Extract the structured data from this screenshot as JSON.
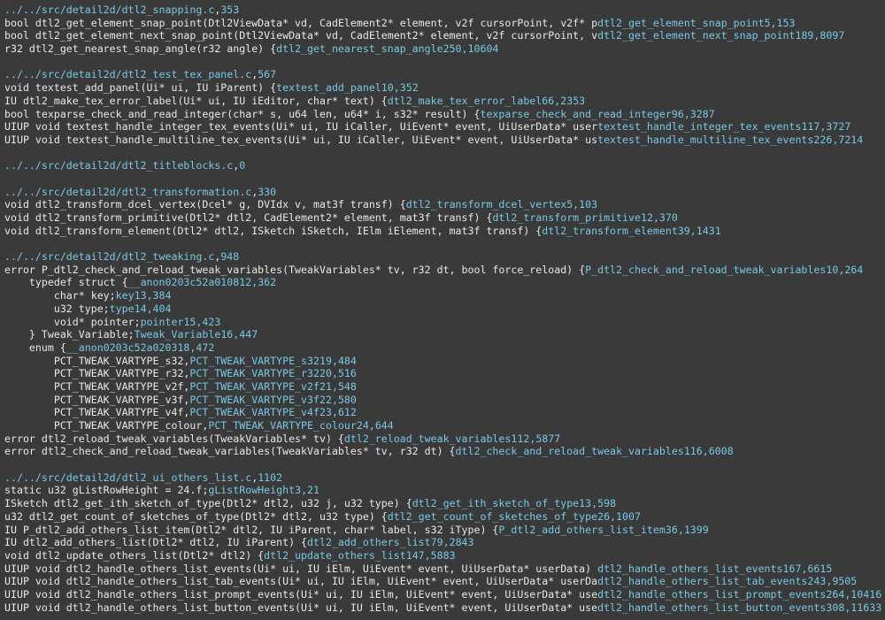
{
  "colors": {
    "background": "#3a3a3a",
    "code_text": "#e8e8e8",
    "tag_text": "#78c8e6"
  },
  "lines": [
    {
      "type": "file",
      "path": "../../src/detail2d/dtl2_snapping.c",
      "size": "353"
    },
    {
      "type": "code",
      "text": "bool dtl2_get_element_snap_point(Dtl2ViewData* vd, CadElement2* element, v2f cursorPoint, v2f* p",
      "tag": "dtl2_get_element_snap_point",
      "a": "5",
      "b": "153"
    },
    {
      "type": "code",
      "text": "bool dtl2_get_element_next_snap_point(Dtl2ViewData* vd, CadElement2* element, v2f cursorPoint, v",
      "tag": "dtl2_get_element_next_snap_point",
      "a": "189",
      "b": "8097"
    },
    {
      "type": "code",
      "text": "r32 dtl2_get_nearest_snap_angle(r32 angle) {",
      "tag": "dtl2_get_nearest_snap_angle",
      "a": "250",
      "b": "10604"
    },
    {
      "type": "blank"
    },
    {
      "type": "file",
      "path": "../../src/detail2d/dtl2_test_tex_panel.c",
      "size": "567"
    },
    {
      "type": "code",
      "text": "void textest_add_panel(Ui* ui, IU iParent) {",
      "tag": "textest_add_panel",
      "a": "10",
      "b": "352"
    },
    {
      "type": "code",
      "text": "IU dtl2_make_tex_error_label(Ui* ui, IU iEditor, char* text) {",
      "tag": "dtl2_make_tex_error_label",
      "a": "66",
      "b": "2353"
    },
    {
      "type": "code",
      "text": "bool texparse_check_and_read_integer(char* s, u64 len, u64* i, s32* result) {",
      "tag": "texparse_check_and_read_integer",
      "a": "96",
      "b": "3287"
    },
    {
      "type": "code",
      "text": "UIUP void textest_handle_integer_tex_events(Ui* ui, IU iCaller, UiEvent* event, UiUserData* user",
      "tag": "textest_handle_integer_tex_events",
      "a": "117",
      "b": "3727"
    },
    {
      "type": "code",
      "text": "UIUP void textest_handle_multiline_tex_events(Ui* ui, IU iCaller, UiEvent* event, UiUserData* us",
      "tag": "textest_handle_multiline_tex_events",
      "a": "226",
      "b": "7214"
    },
    {
      "type": "blank"
    },
    {
      "type": "file",
      "path": "../../src/detail2d/dtl2_titleblocks.c",
      "size": "0"
    },
    {
      "type": "blank"
    },
    {
      "type": "file",
      "path": "../../src/detail2d/dtl2_transformation.c",
      "size": "330"
    },
    {
      "type": "code",
      "text": "void dtl2_transform_dcel_vertex(Dcel* g, DVIdx v, mat3f transf) {",
      "tag": "dtl2_transform_dcel_vertex",
      "a": "5",
      "b": "103"
    },
    {
      "type": "code",
      "text": "void dtl2_transform_primitive(Dtl2* dtl2, CadElement2* element, mat3f transf) {",
      "tag": "dtl2_transform_primitive",
      "a": "12",
      "b": "370"
    },
    {
      "type": "code",
      "text": "void dtl2_transform_element(Dtl2* dtl2, ISketch iSketch, IElm iElement, mat3f transf) {",
      "tag": "dtl2_transform_element",
      "a": "39",
      "b": "1431"
    },
    {
      "type": "blank"
    },
    {
      "type": "file",
      "path": "../../src/detail2d/dtl2_tweaking.c",
      "size": "948"
    },
    {
      "type": "code",
      "text": "error P_dtl2_check_and_reload_tweak_variables(TweakVariables* tv, r32 dt, bool force_reload) {",
      "tag": "P_dtl2_check_and_reload_tweak_variables",
      "a": "10",
      "b": "264"
    },
    {
      "type": "code",
      "text": "    typedef struct {",
      "tag": "__anon0203c52a0108",
      "a": "12",
      "b": "362"
    },
    {
      "type": "code",
      "text": "        char* key;",
      "tag": "key",
      "a": "13",
      "b": "384"
    },
    {
      "type": "code",
      "text": "        u32 type;",
      "tag": "type",
      "a": "14",
      "b": "404"
    },
    {
      "type": "code",
      "text": "        void* pointer;",
      "tag": "pointer",
      "a": "15",
      "b": "423"
    },
    {
      "type": "code",
      "text": "    } Tweak_Variable;",
      "tag": "Tweak_Variable",
      "a": "16",
      "b": "447"
    },
    {
      "type": "code",
      "text": "    enum {",
      "tag": "__anon0203c52a0203",
      "a": "18",
      "b": "472"
    },
    {
      "type": "code",
      "text": "        PCT_TWEAK_VARTYPE_s32,",
      "tag": "PCT_TWEAK_VARTYPE_s32",
      "a": "19",
      "b": "484"
    },
    {
      "type": "code",
      "text": "        PCT_TWEAK_VARTYPE_r32,",
      "tag": "PCT_TWEAK_VARTYPE_r32",
      "a": "20",
      "b": "516"
    },
    {
      "type": "code",
      "text": "        PCT_TWEAK_VARTYPE_v2f,",
      "tag": "PCT_TWEAK_VARTYPE_v2f",
      "a": "21",
      "b": "548"
    },
    {
      "type": "code",
      "text": "        PCT_TWEAK_VARTYPE_v3f,",
      "tag": "PCT_TWEAK_VARTYPE_v3f",
      "a": "22",
      "b": "580"
    },
    {
      "type": "code",
      "text": "        PCT_TWEAK_VARTYPE_v4f,",
      "tag": "PCT_TWEAK_VARTYPE_v4f",
      "a": "23",
      "b": "612"
    },
    {
      "type": "code",
      "text": "        PCT_TWEAK_VARTYPE_colour,",
      "tag": "PCT_TWEAK_VARTYPE_colour",
      "a": "24",
      "b": "644"
    },
    {
      "type": "code",
      "text": "error dtl2_reload_tweak_variables(TweakVariables* tv) {",
      "tag": "dtl2_reload_tweak_variables",
      "a": "112",
      "b": "5877"
    },
    {
      "type": "code",
      "text": "error dtl2_check_and_reload_tweak_variables(TweakVariables* tv, r32 dt) {",
      "tag": "dtl2_check_and_reload_tweak_variables",
      "a": "116",
      "b": "6008"
    },
    {
      "type": "blank"
    },
    {
      "type": "file",
      "path": "../../src/detail2d/dtl2_ui_others_list.c",
      "size": "1102"
    },
    {
      "type": "code",
      "text": "static u32 gListRowHeight = 24.f;",
      "tag": "gListRowHeight",
      "a": "3",
      "b": "21"
    },
    {
      "type": "code",
      "text": "ISketch dtl2_get_ith_sketch_of_type(Dtl2* dtl2, u32 j, u32 type) {",
      "tag": "dtl2_get_ith_sketch_of_type",
      "a": "13",
      "b": "598"
    },
    {
      "type": "code",
      "text": "u32 dtl2_get_count_of_sketches_of_type(Dtl2* dtl2, u32 type) {",
      "tag": "dtl2_get_count_of_sketches_of_type",
      "a": "26",
      "b": "1007"
    },
    {
      "type": "code",
      "text": "IU P_dtl2_add_others_list_item(Dtl2* dtl2, IU iParent, char* label, s32 iType) {",
      "tag": "P_dtl2_add_others_list_item",
      "a": "36",
      "b": "1399"
    },
    {
      "type": "code",
      "text": "IU dtl2_add_others_list(Dtl2* dtl2, IU iParent) {",
      "tag": "dtl2_add_others_list",
      "a": "79",
      "b": "2843"
    },
    {
      "type": "code",
      "text": "void dtl2_update_others_list(Dtl2* dtl2) {",
      "tag": "dtl2_update_others_list",
      "a": "147",
      "b": "5883"
    },
    {
      "type": "code",
      "text": "UIUP void dtl2_handle_others_list_events(Ui* ui, IU iElm, UiEvent* event, UiUserData* userData) ",
      "tag": "dtl2_handle_others_list_events",
      "a": "167",
      "b": "6615"
    },
    {
      "type": "code",
      "text": "UIUP void dtl2_handle_others_list_tab_events(Ui* ui, IU iElm, UiEvent* event, UiUserData* userDa",
      "tag": "dtl2_handle_others_list_tab_events",
      "a": "243",
      "b": "9505"
    },
    {
      "type": "code",
      "text": "UIUP void dtl2_handle_others_list_prompt_events(Ui* ui, IU iElm, UiEvent* event, UiUserData* use",
      "tag": "dtl2_handle_others_list_prompt_events",
      "a": "264",
      "b": "10416"
    },
    {
      "type": "code",
      "text": "UIUP void dtl2_handle_others_list_button_events(Ui* ui, IU iElm, UiEvent* event, UiUserData* use",
      "tag": "dtl2_handle_others_list_button_events",
      "a": "308",
      "b": "11633"
    }
  ]
}
